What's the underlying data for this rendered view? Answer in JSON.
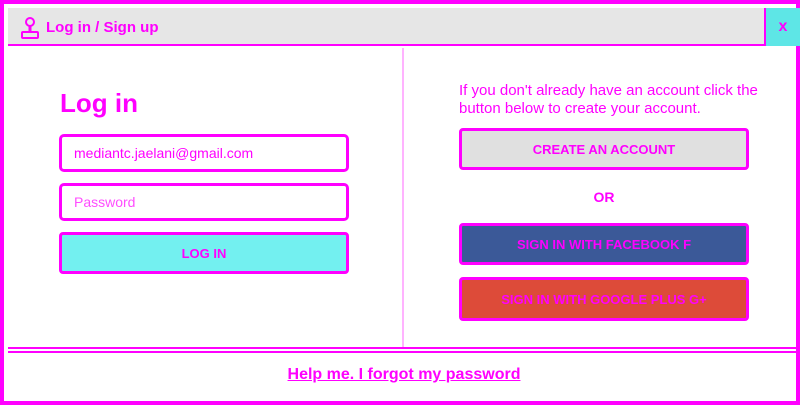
{
  "header": {
    "title": "Log in / Sign up",
    "icon": "joystick-icon",
    "close_label": "x"
  },
  "login": {
    "title": "Log in",
    "email_value": "mediantc.jaelani@gmail.com",
    "password_placeholder": "Password",
    "login_button": "LOG IN"
  },
  "signup": {
    "description": "If you don't already have an account click the button below to create your account.",
    "create_button": "CREATE AN ACCOUNT",
    "or_label": "OR",
    "facebook_button": "SIGN IN WITH FACEBOOK f",
    "google_button": "SIGN IN WITH GOOGLE PLUS g+"
  },
  "footer": {
    "forgot_link": "Help me. I forgot my password"
  },
  "colors": {
    "accent": "#ff00ff",
    "cyan": "#73f0f0",
    "facebook": "#3b5998",
    "google": "#dd4b39",
    "grey": "#e0e0e0"
  }
}
